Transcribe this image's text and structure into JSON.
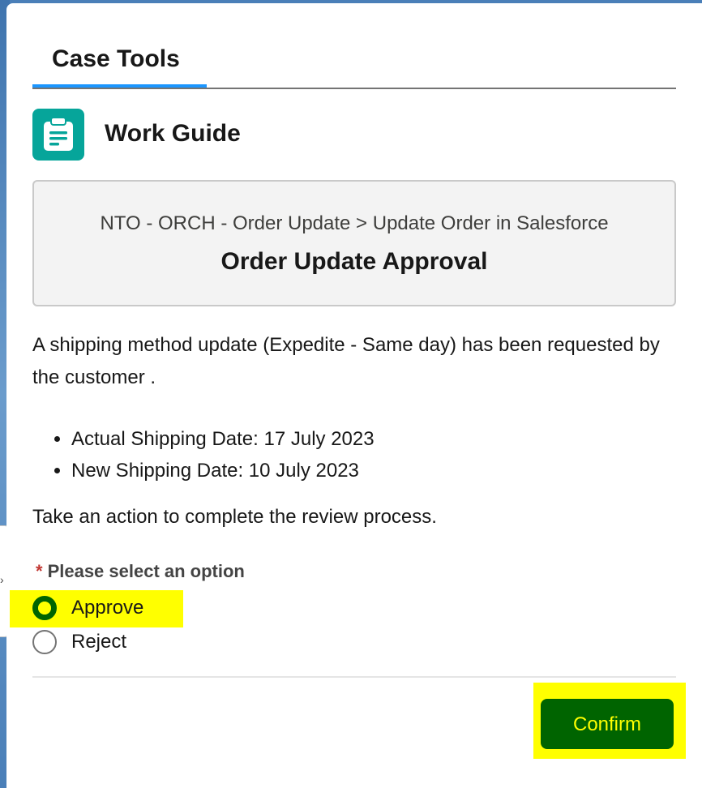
{
  "tabs": [
    {
      "label": "Case Tools",
      "active": true
    }
  ],
  "work_guide": {
    "title": "Work Guide",
    "icon": "clipboard-icon",
    "icon_color": "#06a59a"
  },
  "step": {
    "breadcrumb": "NTO - ORCH - Order Update > Update Order in Salesforce",
    "title": "Order Update Approval"
  },
  "content": {
    "description": "A shipping method update (Expedite - Same day) has been requested by the customer .",
    "bullets": [
      "Actual Shipping Date: 17 July 2023",
      "New Shipping Date: 10 July 2023"
    ],
    "instruction": "Take an action to complete the review process."
  },
  "form": {
    "required_marker": "*",
    "question": "Please select an option",
    "options": [
      {
        "label": "Approve",
        "selected": true
      },
      {
        "label": "Reject",
        "selected": false
      }
    ],
    "confirm_label": "Confirm"
  },
  "colors": {
    "accent_tab": "#1b96ff",
    "highlight": "#ffff00",
    "confirm_bg": "#006400"
  }
}
